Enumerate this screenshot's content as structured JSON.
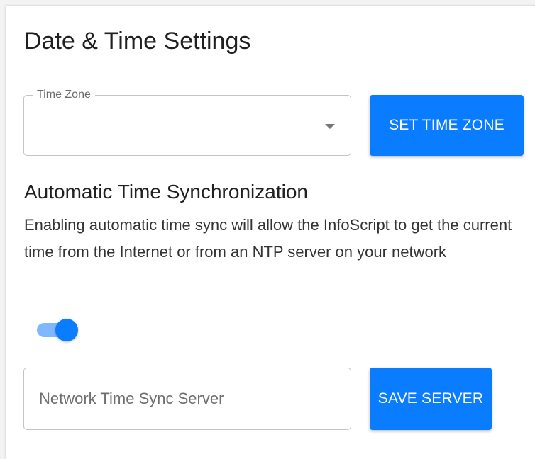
{
  "page": {
    "title": "Date & Time Settings"
  },
  "timezone": {
    "label": "Time Zone",
    "value": "",
    "button_label": "SET TIME ZONE"
  },
  "auto_sync": {
    "heading": "Automatic Time Synchronization",
    "description": "Enabling automatic time sync will allow the InfoScript to get the current time from the Internet or from an NTP server on your network",
    "enabled": true
  },
  "ntp_server": {
    "placeholder": "Network Time Sync Server",
    "value": "",
    "button_label": "SAVE SERVER"
  },
  "colors": {
    "accent": "#0a7cff",
    "accent_light": "#7fb8ff"
  },
  "icons": {
    "dropdown": "triangle-down-icon"
  }
}
